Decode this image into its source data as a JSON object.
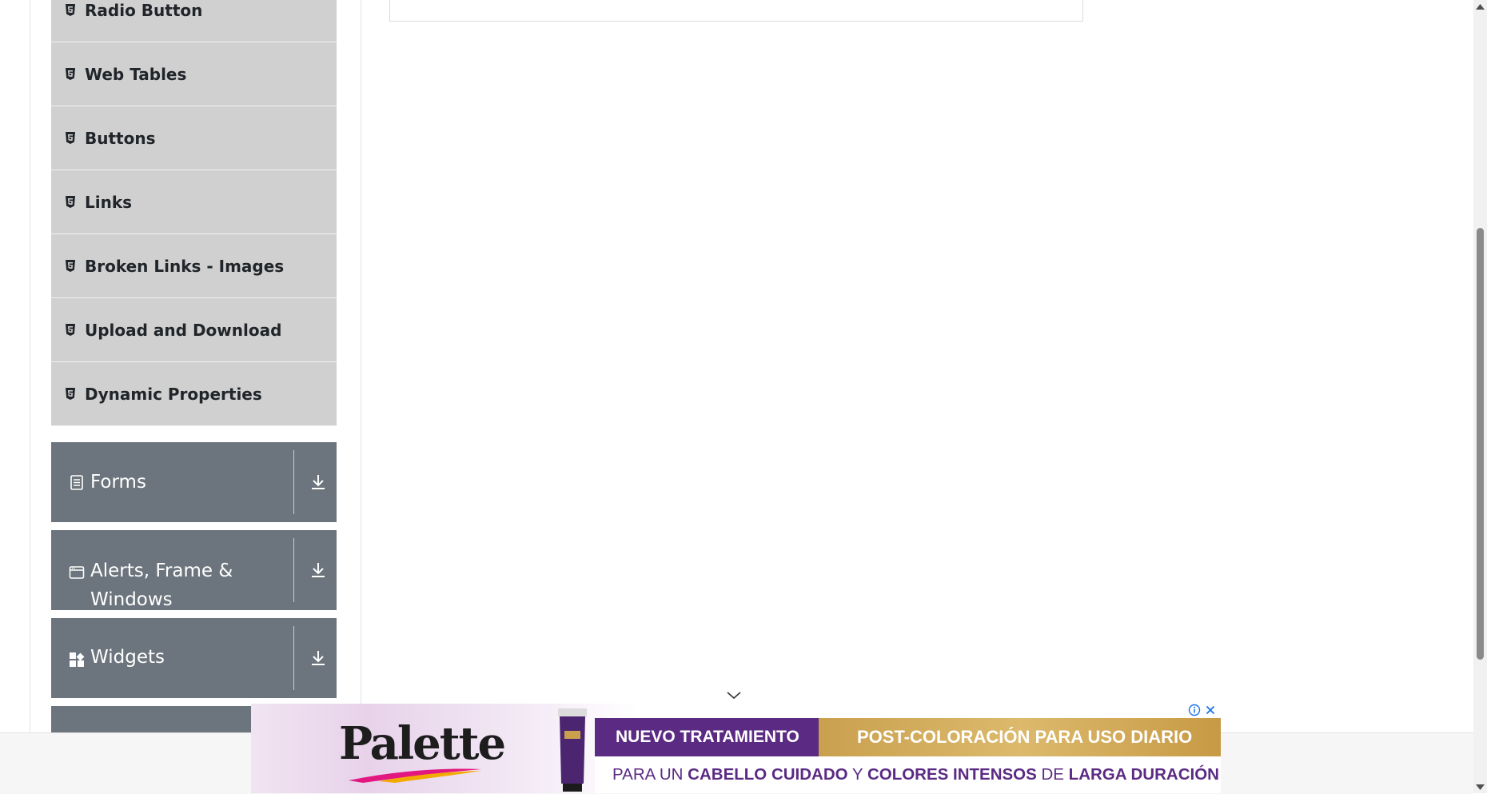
{
  "sidebar": {
    "elements_items": [
      {
        "label": "Radio Button",
        "icon": "html5-file-icon"
      },
      {
        "label": "Web Tables",
        "icon": "html5-file-icon"
      },
      {
        "label": "Buttons",
        "icon": "html5-file-icon"
      },
      {
        "label": "Links",
        "icon": "html5-file-icon"
      },
      {
        "label": "Broken Links - Images",
        "icon": "html5-file-icon"
      },
      {
        "label": "Upload and Download",
        "icon": "html5-file-icon"
      },
      {
        "label": "Dynamic Properties",
        "icon": "html5-file-icon"
      }
    ],
    "groups": [
      {
        "label": "Forms",
        "icon": "form-document-icon"
      },
      {
        "label_line1": "Alerts, Frame &",
        "label_line2": "Windows",
        "icon": "window-icon"
      },
      {
        "label": "Widgets",
        "icon": "widgets-grid-icon"
      }
    ]
  },
  "ad": {
    "brand": "Palette",
    "headline1": "NUEVO TRATAMIENTO",
    "headline2": "POST-COLORACIÓN PARA USO DIARIO",
    "line2_a": "PARA UN ",
    "line2_b": "CABELLO CUIDADO",
    "line2_c": " Y ",
    "line2_d": "COLORES INTENSOS",
    "line2_e": " DE ",
    "line2_f": "LARGA DURACIÓN"
  },
  "colors": {
    "group_bg": "#6c757d",
    "item_bg": "#d0d0d0",
    "ad_purple": "#5b2a83",
    "ad_gold": "#c9a04e",
    "ad_icon_blue": "#1a73e8"
  }
}
